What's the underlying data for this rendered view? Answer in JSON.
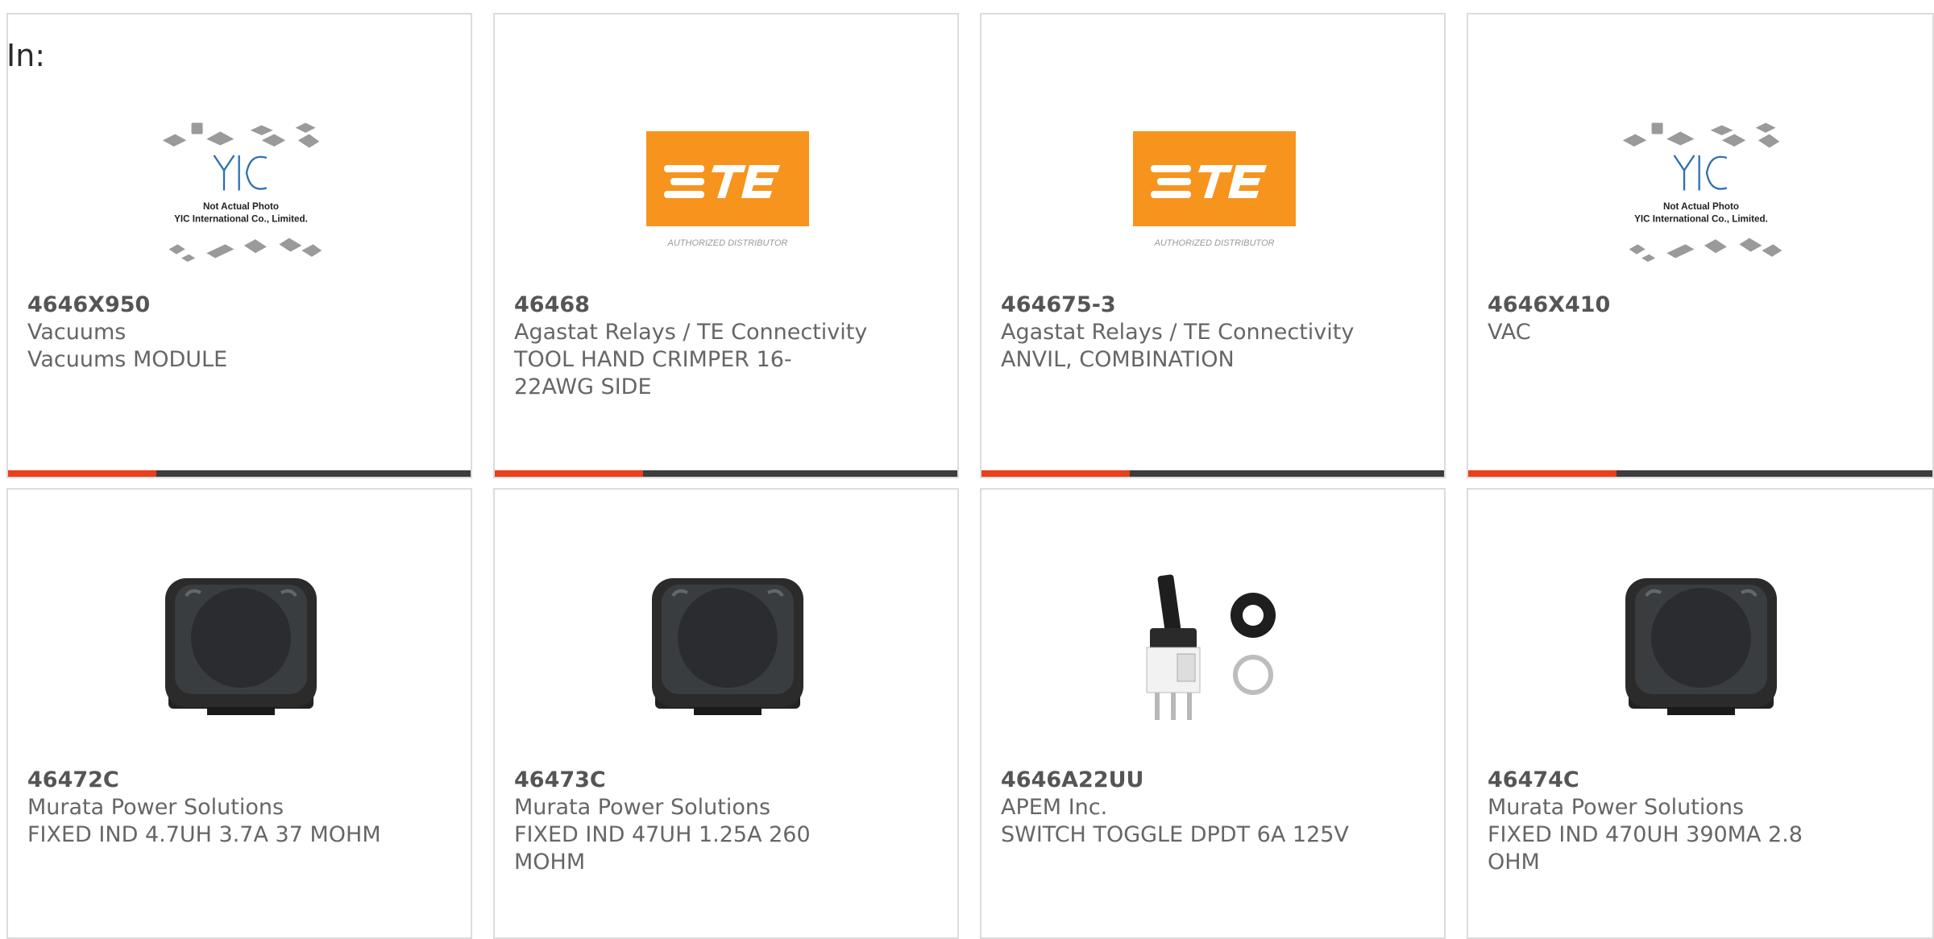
{
  "filter": {
    "label": "In:"
  },
  "colors": {
    "accent": "#e8401c",
    "bar": "#3d3d3d",
    "te_orange": "#f7941d"
  },
  "placeholder": {
    "line1": "Not Actual Photo",
    "line2": "YIC International Co., Limited."
  },
  "te_logo": {
    "tagline": "AUTHORIZED DISTRIBUTOR"
  },
  "products": [
    {
      "part": "4646X950",
      "manufacturer": "Vacuums",
      "description": "Vacuums MODULE",
      "image": "yic-placeholder"
    },
    {
      "part": "46468",
      "manufacturer": "Agastat Relays / TE Connectivity",
      "description": "TOOL HAND CRIMPER 16-22AWG SIDE",
      "image": "te-logo"
    },
    {
      "part": "464675-3",
      "manufacturer": "Agastat Relays / TE Connectivity",
      "description": "ANVIL, COMBINATION",
      "image": "te-logo"
    },
    {
      "part": "4646X410",
      "manufacturer": "VAC",
      "description": "",
      "image": "yic-placeholder"
    },
    {
      "part": "46472C",
      "manufacturer": "Murata Power Solutions",
      "description": "FIXED IND 4.7UH 3.7A 37 MOHM",
      "image": "inductor-photo"
    },
    {
      "part": "46473C",
      "manufacturer": "Murata Power Solutions",
      "description": "FIXED IND 47UH 1.25A 260 MOHM",
      "image": "inductor-photo"
    },
    {
      "part": "4646A22UU",
      "manufacturer": "APEM Inc.",
      "description": "SWITCH TOGGLE DPDT 6A 125V",
      "image": "toggle-switch-photo"
    },
    {
      "part": "46474C",
      "manufacturer": "Murata Power Solutions",
      "description": "FIXED IND 470UH 390MA 2.8 OHM",
      "image": "inductor-photo"
    }
  ]
}
